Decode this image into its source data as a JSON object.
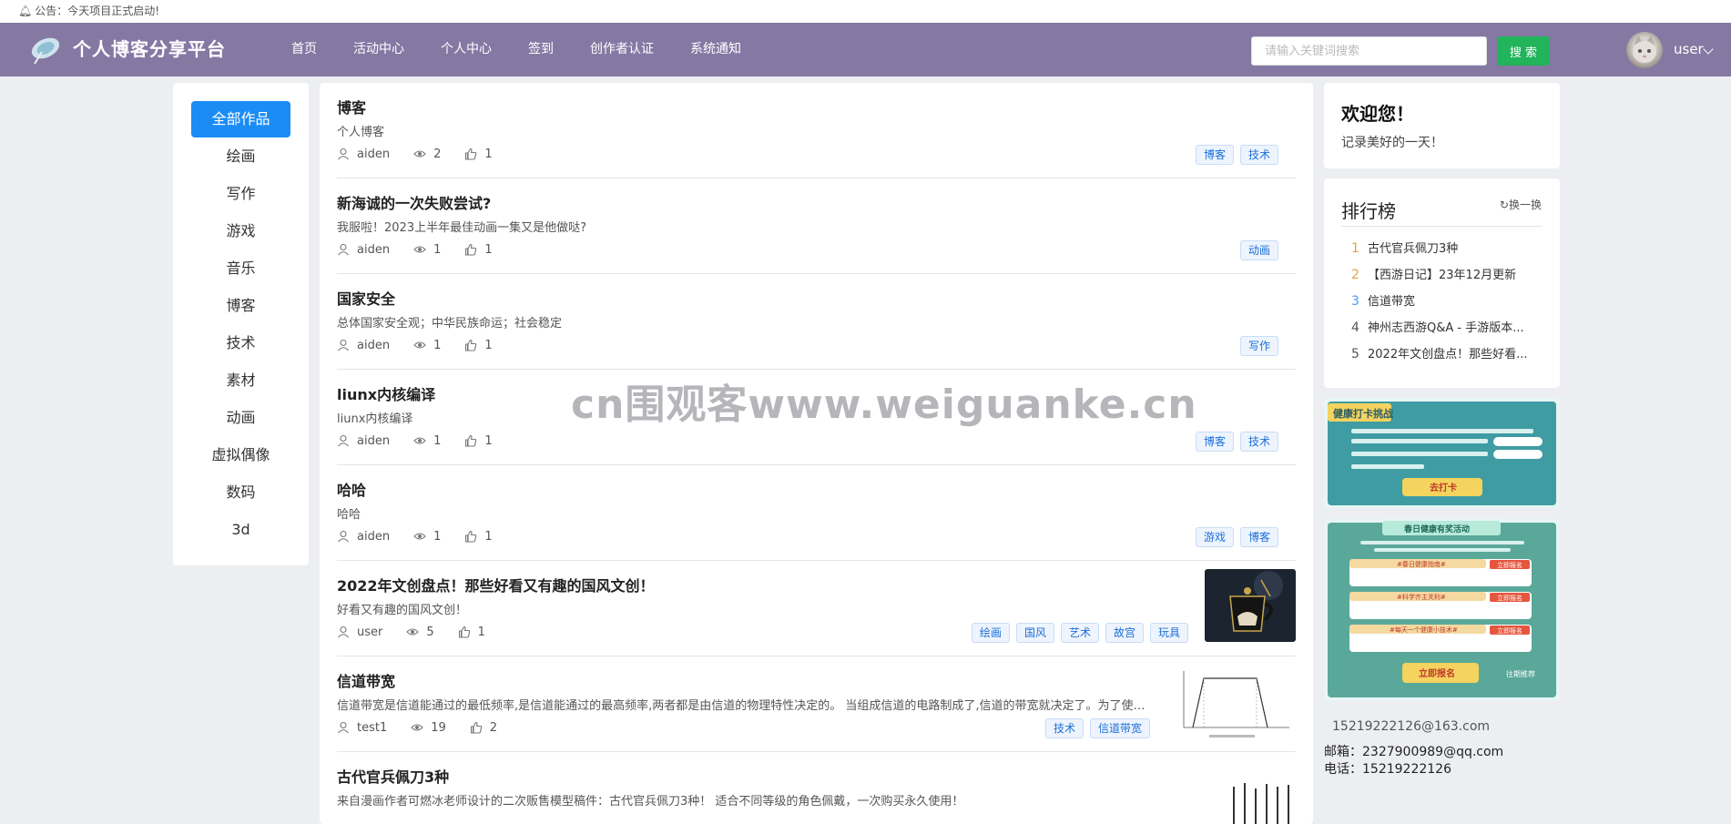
{
  "notice": {
    "text": "公告：今天项目正式启动!"
  },
  "header": {
    "brand": "个人博客分享平台",
    "nav": [
      "首页",
      "活动中心",
      "个人中心",
      "签到",
      "创作者认证",
      "系统通知"
    ],
    "search_placeholder": "请输入关键词搜索",
    "search_button": "搜 索",
    "username": "user"
  },
  "categories": [
    "全部作品",
    "绘画",
    "写作",
    "游戏",
    "音乐",
    "博客",
    "技术",
    "素材",
    "动画",
    "虚拟偶像",
    "数码",
    "3d"
  ],
  "posts": [
    {
      "title": "博客",
      "desc": "个人博客",
      "author": "aiden",
      "views": "2",
      "likes": "1",
      "tags": [
        "博客",
        "技术"
      ]
    },
    {
      "title": "新海诚的一次失败尝试?",
      "desc": "我服啦！2023上半年最佳动画一集又是他做哒?",
      "author": "aiden",
      "views": "1",
      "likes": "1",
      "tags": [
        "动画"
      ]
    },
    {
      "title": "国家安全",
      "desc": "总体国家安全观；中华民族命运；社会稳定",
      "author": "aiden",
      "views": "1",
      "likes": "1",
      "tags": [
        "写作"
      ]
    },
    {
      "title": "liunx内核编译",
      "desc": "liunx内核编译",
      "author": "aiden",
      "views": "1",
      "likes": "1",
      "tags": [
        "博客",
        "技术"
      ]
    },
    {
      "title": "哈哈",
      "desc": "哈哈",
      "author": "aiden",
      "views": "1",
      "likes": "1",
      "tags": [
        "游戏",
        "博客"
      ]
    },
    {
      "title": "2022年文创盘点！那些好看又有趣的国风文创！",
      "desc": "好看又有趣的国风文创！",
      "author": "user",
      "views": "5",
      "likes": "1",
      "tags": [
        "绘画",
        "国风",
        "艺术",
        "故宫",
        "玩具"
      ]
    },
    {
      "title": "信道带宽",
      "desc": "信道带宽是信道能通过的最低频率,是信道能通过的最高频率,两者都是由信道的物理特性决定的。 当组成信道的电路制成了,信道的带宽就决定了。为了使信...",
      "author": "test1",
      "views": "19",
      "likes": "2",
      "tags": [
        "技术",
        "信道带宽"
      ]
    },
    {
      "title": "古代官兵佩刀3种",
      "desc": "来自漫画作者可燃冰老师设计的二次贩售模型稿件：古代官兵佩刀3种！  适合不同等级的角色佩戴，一次购买永久使用！",
      "author": "",
      "views": "",
      "likes": "",
      "tags": []
    }
  ],
  "welcome": {
    "title": "欢迎您！",
    "subtitle": "记录美好的一天！"
  },
  "ranking": {
    "title": "排行榜",
    "refresh": "换一换",
    "items": [
      {
        "num": "1",
        "text": "古代官兵佩刀3种",
        "color": "#e6a23c"
      },
      {
        "num": "2",
        "text": "【西游日记】23年12月更新",
        "color": "#e6a23c"
      },
      {
        "num": "3",
        "text": "信道带宽",
        "color": "#409eff"
      },
      {
        "num": "4",
        "text": "神州志西游Q&A - 手游版本...",
        "color": "#555555"
      },
      {
        "num": "5",
        "text": "2022年文创盘点！那些好看...",
        "color": "#555555"
      }
    ]
  },
  "banners": {
    "b1": {
      "title": "健康打卡挑战",
      "button": "去打卡"
    },
    "b2": {
      "title": "春日健康有奖活动",
      "rows": [
        "#春日健康指南#",
        "#科学齐主关利#",
        "#每天一个健康小技术#"
      ],
      "row_button": "立即报名",
      "button": "立即报名",
      "more": "往期推荐"
    }
  },
  "contact": {
    "qq_mail": "15219222126@163.com",
    "mail": "邮箱：2327900989@qq.com",
    "phone": "电话：15219222126"
  },
  "watermark": "cn围观客www.weiguanke.cn",
  "colors": {
    "header_bg": "#8579a3",
    "primary": "#1c8cf5",
    "search_btn": "#21b45b"
  }
}
